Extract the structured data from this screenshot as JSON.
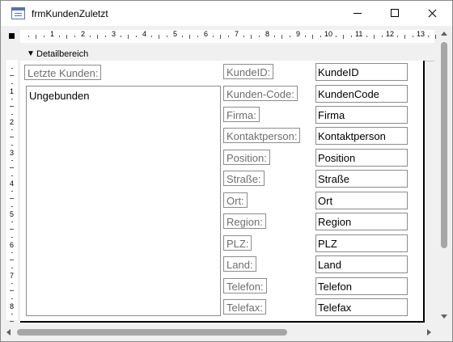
{
  "window": {
    "title": "frmKundenZuletzt"
  },
  "ruler": {
    "marks": [
      "1",
      "2",
      "3",
      "4",
      "5",
      "6",
      "7",
      "8",
      "9",
      "10",
      "11",
      "12",
      "13"
    ]
  },
  "vruler": {
    "marks": [
      "1",
      "2",
      "3",
      "4",
      "5",
      "6",
      "7",
      "8"
    ]
  },
  "section": {
    "label": "Detailbereich"
  },
  "form": {
    "left_label": "Letzte Kunden:",
    "list_value": "Ungebunden",
    "fields": [
      {
        "label": "KundeID:",
        "value": "KundeID"
      },
      {
        "label": "Kunden-Code:",
        "value": "KundenCode"
      },
      {
        "label": "Firma:",
        "value": "Firma"
      },
      {
        "label": "Kontaktperson:",
        "value": "Kontaktperson"
      },
      {
        "label": "Position:",
        "value": "Position"
      },
      {
        "label": "Straße:",
        "value": "Straße"
      },
      {
        "label": "Ort:",
        "value": "Ort"
      },
      {
        "label": "Region:",
        "value": "Region"
      },
      {
        "label": "PLZ:",
        "value": "PLZ"
      },
      {
        "label": "Land:",
        "value": "Land"
      },
      {
        "label": "Telefon:",
        "value": "Telefon"
      },
      {
        "label": "Telefax:",
        "value": "Telefax"
      }
    ]
  }
}
